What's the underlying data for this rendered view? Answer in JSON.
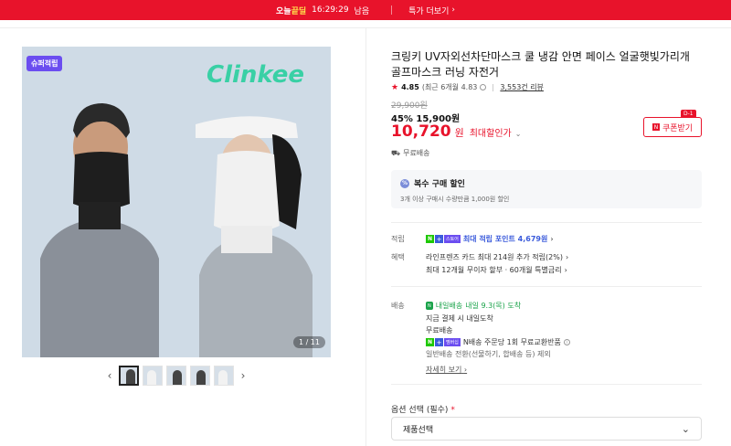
{
  "topbar": {
    "brand_prefix": "오늘",
    "brand_highlight": "끝딜",
    "countdown": "16:29:29",
    "countdown_suffix": "남음",
    "more_label": "특가 더보기",
    "more_icon": "chevron-right"
  },
  "gallery": {
    "badge": "슈퍼적립",
    "brand_logo_text": "Clinkee",
    "counter": "1 / 11",
    "prev_icon": "chevron-left",
    "next_icon": "chevron-right",
    "thumbnail_count": 5
  },
  "product": {
    "title": "크링키 UV자외선차단마스크 쿨 냉감 안면 페이스 얼굴햇빛가리개 골프마스크 러닝 자전거",
    "rating_score": "4.85",
    "rating_recent": "(최근 6개월 4.83",
    "review_count": "3,553건 리뷰",
    "original_price": "29,900원",
    "discount_rate": "45%",
    "sale_price": "15,900원",
    "final_price": "10,720",
    "final_price_unit": "원",
    "final_price_label": "최대할인가",
    "coupon_label": "쿠폰받기",
    "coupon_badge": "D-1",
    "shipping": "무료배송"
  },
  "multi_discount": {
    "title": "복수 구매 할인",
    "desc": "3개 이상 구매시 수량만큼 1,000원 할인"
  },
  "benefits": {
    "points_label": "적립",
    "points_value": "최대 적립 포인트 4,679원",
    "benefit_label": "혜택",
    "benefit_line1": "라인프렌즈 카드 최대 214원 추가 적립(2%)",
    "benefit_line2": "최대 12개월 무이자 할부 · 60개월 특별금리"
  },
  "delivery": {
    "label": "배송",
    "tag": "내일배송",
    "arrival": "내일 9.3(목) 도착",
    "condition": "지금 결제 시 내일도착",
    "fee": "무료배송",
    "exchange": "N배송 주문당 1회 무료교환반품",
    "exclusion": "일반배송 전환(선물하기, 합배송 등) 제외",
    "detail_link": "자세히 보기"
  },
  "options": {
    "label": "옵션 선택 (필수)",
    "required_mark": "*",
    "select_value": "제품선택"
  },
  "colors": {
    "accent": "#e8132b",
    "npay_green": "#1ec800",
    "point_blue": "#3b5bdb",
    "brand_mint": "#39d0a5",
    "badge_purple": "#6b4df0"
  }
}
